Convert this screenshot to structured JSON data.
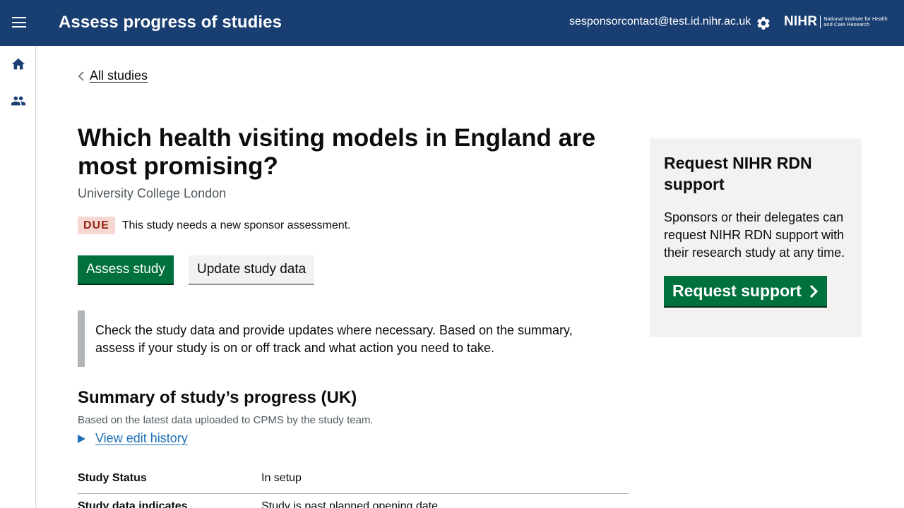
{
  "header": {
    "title": "Assess progress of studies",
    "user_email": "sesponsorcontact@test.id.nihr.ac.uk",
    "logo_main": "NIHR",
    "logo_sub": "National Institute for Health and Care Research"
  },
  "sidebar": {
    "items": [
      {
        "icon": "home-icon"
      },
      {
        "icon": "people-icon"
      }
    ]
  },
  "back_link": "All studies",
  "study": {
    "title": "Which health visiting models in England are most promising?",
    "organisation": "University College London",
    "status_tag": "DUE",
    "status_message": "This study needs a new sponsor assessment."
  },
  "actions": {
    "assess_label": "Assess study",
    "update_label": "Update study data"
  },
  "inset_text": "Check the study data and provide updates where necessary. Based on the summary, assess if your study is on or off track and what action you need to take.",
  "summary": {
    "heading": "Summary of study’s progress (UK)",
    "subheading": "Based on the latest data uploaded to CPMS by the study team.",
    "history_link": "View edit history",
    "rows": [
      {
        "key": "Study Status",
        "value": "In setup"
      },
      {
        "key": "Study data indicates",
        "value": "Study is past planned opening date"
      }
    ]
  },
  "aside": {
    "heading": "Request NIHR RDN support",
    "body": "Sponsors or their delegates can request NIHR RDN support with their research study at any time.",
    "button_label": "Request support"
  },
  "colors": {
    "header_bg": "#193e72",
    "primary_button": "#00703c",
    "due_tag_bg": "#f6d7d2",
    "due_tag_text": "#942514",
    "link": "#1d70b8"
  }
}
